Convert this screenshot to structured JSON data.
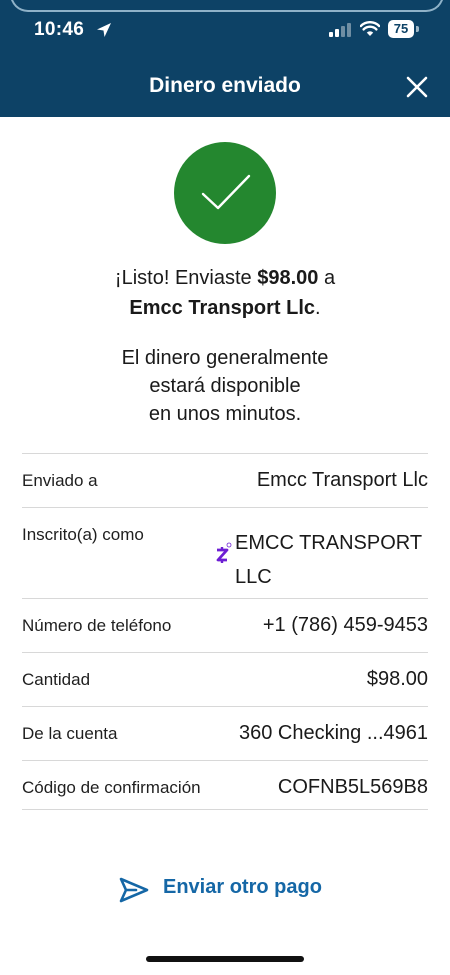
{
  "status_bar": {
    "time": "10:46",
    "battery": "75"
  },
  "header": {
    "title": "Dinero enviado"
  },
  "confirmation": {
    "line1_prefix": "¡Listo! Enviaste ",
    "amount": "$98.00",
    "line1_suffix": " a",
    "recipient": "Emcc Transport Llc",
    "line2_suffix": ".",
    "availability_line1": "El dinero generalmente",
    "availability_line2": "estará disponible",
    "availability_line3": "en unos minutos."
  },
  "details": [
    {
      "label": "Enviado a",
      "value": "Emcc Transport Llc"
    },
    {
      "label": "Inscrito(a) como",
      "value_line1": "EMCC TRANSPORT",
      "value_line2": "LLC"
    },
    {
      "label": "Número de teléfono",
      "value": "+1 (786) 459-9453"
    },
    {
      "label": "Cantidad",
      "value": "$98.00"
    },
    {
      "label": "De la cuenta",
      "value": "360 Checking ...4961"
    },
    {
      "label": "Código de confirmación",
      "value": "COFNB5L569B8"
    }
  ],
  "actions": {
    "send_again": "Enviar otro pago"
  },
  "colors": {
    "header_bg": "#0d4266",
    "success_green": "#24872f",
    "link_blue": "#1567a6",
    "zelle_purple": "#6d1ed4"
  }
}
